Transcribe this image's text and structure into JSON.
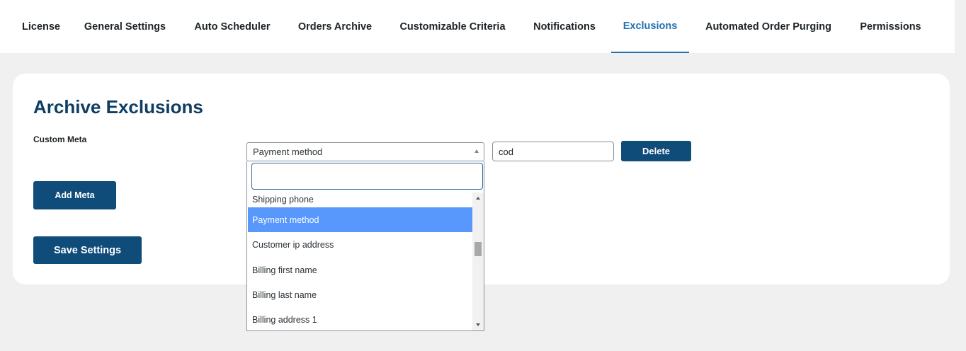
{
  "tabs": [
    {
      "label": "License",
      "active": false
    },
    {
      "label": "General Settings",
      "active": false
    },
    {
      "label": "Auto Scheduler",
      "active": false
    },
    {
      "label": "Orders Archive",
      "active": false
    },
    {
      "label": "Customizable Criteria",
      "active": false
    },
    {
      "label": "Notifications",
      "active": false
    },
    {
      "label": "Exclusions",
      "active": true
    },
    {
      "label": "Automated Order Purging",
      "active": false
    },
    {
      "label": "Permissions",
      "active": false
    }
  ],
  "section": {
    "title": "Archive Exclusions",
    "custom_meta_label": "Custom Meta"
  },
  "meta_row": {
    "selected_key": "Payment method",
    "value": "cod",
    "delete_label": "Delete"
  },
  "dropdown": {
    "search_value": "",
    "options": [
      {
        "label": "Shipping phone",
        "selected": false
      },
      {
        "label": "Payment method",
        "selected": true
      },
      {
        "label": "Customer ip address",
        "selected": false
      },
      {
        "label": "Billing first name",
        "selected": false
      },
      {
        "label": "Billing last name",
        "selected": false
      },
      {
        "label": "Billing address 1",
        "selected": false
      }
    ]
  },
  "buttons": {
    "add_meta": "Add Meta",
    "save_settings": "Save Settings"
  },
  "colors": {
    "accent": "#2271b1",
    "button_bg": "#0f4c7a",
    "title": "#0f3e63",
    "option_highlight": "#5897fb",
    "page_bg": "#f0f0f1"
  }
}
